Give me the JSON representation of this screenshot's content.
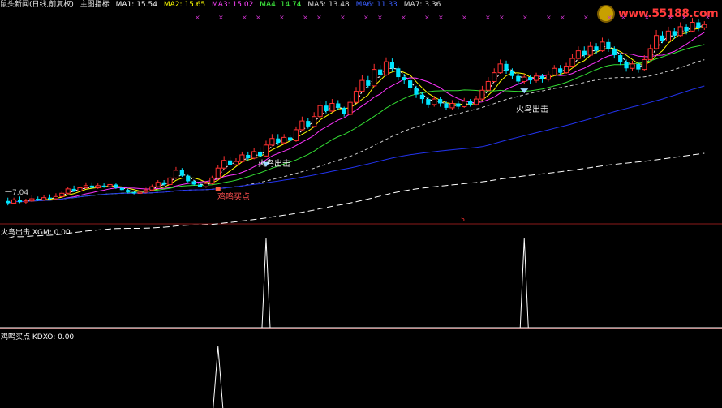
{
  "header": {
    "title": "鼠头新闻(日线,前复权)",
    "indicator": "主图指标",
    "ma_items": [
      {
        "label": "MA1: 15.54",
        "color": "#ffffff"
      },
      {
        "label": "MA2: 15.65",
        "color": "#ffff00"
      },
      {
        "label": "MA3: 15.02",
        "color": "#ff44ff"
      },
      {
        "label": "MA4: 14.74",
        "color": "#44ff44"
      },
      {
        "label": "MA5: 13.48",
        "color": "#dddddd"
      },
      {
        "label": "MA6: 11.33",
        "color": "#3a5fff"
      },
      {
        "label": "MA7: 3.36",
        "color": "#dddddd"
      }
    ]
  },
  "watermark": "www.55188.com",
  "panels": {
    "p2_label": "火鸟出击 XGM: 0.00",
    "p3_label": "鸡鸣买点 KDXO: 0.00"
  },
  "annotations": {
    "a1": "火鸟出击",
    "a2": "火鸟出击",
    "a3": "鸡鸣买点",
    "a4": "一7.04",
    "a5": "5"
  },
  "colors": {
    "up": "#ff3030",
    "down": "#00e5ff",
    "ma_white": "#ffffff",
    "ma_yellow": "#ffff00",
    "ma_magenta": "#ff33ff",
    "ma_green": "#33dd33",
    "ma_light": "#cccccc",
    "ma_blue": "#2233ee",
    "divider": "#8b1a1a"
  },
  "chart_data": {
    "type": "candlestick",
    "candles": [
      [
        8.5,
        8.3,
        8.8,
        8.1
      ],
      [
        8.3,
        8.6,
        8.8,
        8.2
      ],
      [
        8.6,
        8.4,
        8.9,
        8.3
      ],
      [
        8.4,
        8.5,
        8.7,
        8.2
      ],
      [
        8.5,
        8.7,
        9.0,
        8.4
      ],
      [
        8.7,
        8.6,
        8.9,
        8.5
      ],
      [
        8.6,
        8.8,
        9.0,
        8.5
      ],
      [
        8.8,
        8.7,
        9.1,
        8.6
      ],
      [
        8.7,
        8.9,
        9.2,
        8.6
      ],
      [
        8.9,
        9.2,
        9.4,
        8.8
      ],
      [
        9.2,
        9.6,
        9.8,
        9.1
      ],
      [
        9.6,
        9.4,
        9.9,
        9.3
      ],
      [
        9.4,
        9.7,
        10.0,
        9.3
      ],
      [
        9.7,
        9.9,
        10.2,
        9.6
      ],
      [
        9.9,
        9.7,
        10.2,
        9.6
      ],
      [
        9.7,
        9.9,
        10.1,
        9.6
      ],
      [
        9.9,
        9.8,
        10.1,
        9.7
      ],
      [
        9.8,
        10.0,
        10.2,
        9.7
      ],
      [
        10.0,
        9.7,
        10.1,
        9.6
      ],
      [
        9.7,
        9.5,
        9.8,
        9.4
      ],
      [
        9.5,
        9.3,
        9.6,
        9.2
      ],
      [
        9.3,
        9.2,
        9.4,
        9.1
      ],
      [
        9.2,
        9.3,
        9.5,
        9.1
      ],
      [
        9.3,
        9.5,
        9.7,
        9.2
      ],
      [
        9.5,
        9.8,
        10.0,
        9.4
      ],
      [
        9.8,
        10.2,
        10.4,
        9.7
      ],
      [
        10.2,
        10.0,
        10.4,
        9.9
      ],
      [
        10.0,
        10.6,
        10.8,
        9.9
      ],
      [
        10.6,
        11.3,
        11.6,
        10.5
      ],
      [
        11.3,
        10.8,
        11.5,
        10.7
      ],
      [
        10.8,
        10.3,
        10.9,
        10.2
      ],
      [
        10.3,
        10.0,
        10.4,
        9.9
      ],
      [
        10.0,
        9.8,
        10.1,
        9.7
      ],
      [
        9.8,
        10.1,
        10.3,
        9.7
      ],
      [
        10.1,
        10.6,
        10.8,
        10.0
      ],
      [
        10.6,
        11.5,
        11.8,
        10.5
      ],
      [
        11.5,
        12.2,
        12.6,
        11.4
      ],
      [
        12.2,
        11.8,
        12.5,
        11.6
      ],
      [
        11.8,
        12.1,
        12.4,
        11.7
      ],
      [
        12.1,
        12.7,
        13.0,
        12.0
      ],
      [
        12.7,
        12.4,
        13.0,
        12.2
      ],
      [
        12.4,
        13.0,
        13.3,
        12.3
      ],
      [
        13.0,
        12.6,
        13.4,
        12.5
      ],
      [
        12.6,
        13.6,
        14.0,
        12.5
      ],
      [
        13.6,
        14.2,
        14.6,
        13.5
      ],
      [
        14.2,
        13.8,
        14.6,
        13.6
      ],
      [
        13.8,
        14.3,
        14.6,
        13.7
      ],
      [
        14.3,
        14.0,
        14.5,
        13.8
      ],
      [
        14.0,
        15.0,
        15.3,
        13.9
      ],
      [
        15.0,
        15.8,
        16.2,
        14.9
      ],
      [
        15.8,
        15.3,
        16.1,
        15.1
      ],
      [
        15.3,
        16.2,
        16.6,
        15.2
      ],
      [
        16.2,
        17.2,
        17.6,
        16.1
      ],
      [
        17.2,
        16.7,
        17.6,
        16.5
      ],
      [
        16.7,
        17.4,
        17.8,
        16.6
      ],
      [
        17.4,
        17.0,
        17.7,
        16.8
      ],
      [
        17.0,
        16.4,
        17.1,
        16.2
      ],
      [
        16.4,
        17.5,
        17.9,
        16.3
      ],
      [
        17.5,
        18.5,
        18.9,
        17.4
      ],
      [
        18.5,
        19.5,
        20.0,
        18.4
      ],
      [
        19.5,
        19.0,
        19.9,
        18.8
      ],
      [
        19.0,
        20.5,
        21.0,
        18.9
      ],
      [
        20.5,
        20.0,
        20.9,
        19.7
      ],
      [
        20.0,
        21.2,
        21.6,
        19.9
      ],
      [
        21.2,
        20.6,
        21.5,
        20.3
      ],
      [
        20.6,
        19.8,
        20.8,
        19.5
      ],
      [
        19.8,
        19.5,
        20.1,
        19.2
      ],
      [
        19.5,
        18.8,
        19.8,
        18.5
      ],
      [
        18.8,
        18.2,
        19.0,
        17.9
      ],
      [
        18.2,
        17.8,
        18.4,
        17.4
      ],
      [
        17.8,
        17.3,
        18.0,
        17.0
      ],
      [
        17.3,
        17.8,
        18.1,
        17.1
      ],
      [
        17.8,
        17.4,
        18.0,
        17.1
      ],
      [
        17.4,
        17.0,
        17.6,
        16.8
      ],
      [
        17.0,
        17.4,
        17.7,
        16.8
      ],
      [
        17.4,
        17.1,
        17.6,
        16.9
      ],
      [
        17.1,
        17.6,
        17.9,
        17.0
      ],
      [
        17.6,
        17.3,
        17.8,
        17.1
      ],
      [
        17.3,
        17.8,
        18.1,
        17.2
      ],
      [
        17.8,
        18.6,
        19.0,
        17.7
      ],
      [
        18.6,
        19.4,
        19.8,
        18.5
      ],
      [
        19.4,
        20.2,
        20.6,
        19.3
      ],
      [
        20.2,
        21.0,
        21.4,
        20.1
      ],
      [
        21.0,
        20.4,
        21.3,
        20.1
      ],
      [
        20.4,
        19.9,
        20.6,
        19.6
      ],
      [
        19.9,
        19.4,
        20.1,
        19.1
      ],
      [
        19.4,
        19.8,
        20.1,
        19.2
      ],
      [
        19.8,
        19.5,
        20.0,
        19.2
      ],
      [
        19.5,
        19.9,
        20.2,
        19.3
      ],
      [
        19.9,
        19.6,
        20.1,
        19.3
      ],
      [
        19.6,
        20.0,
        20.3,
        19.4
      ],
      [
        20.0,
        20.6,
        20.9,
        19.9
      ],
      [
        20.6,
        20.2,
        20.9,
        20.0
      ],
      [
        20.2,
        20.8,
        21.1,
        20.1
      ],
      [
        20.8,
        21.5,
        21.9,
        20.7
      ],
      [
        21.5,
        22.2,
        22.6,
        21.4
      ],
      [
        22.2,
        21.8,
        22.6,
        21.6
      ],
      [
        21.8,
        22.6,
        23.0,
        21.7
      ],
      [
        22.6,
        22.2,
        22.9,
        21.9
      ],
      [
        22.2,
        23.0,
        23.4,
        22.1
      ],
      [
        23.0,
        22.4,
        23.3,
        22.1
      ],
      [
        22.4,
        21.8,
        22.6,
        21.5
      ],
      [
        21.8,
        21.2,
        22.0,
        20.9
      ],
      [
        21.2,
        20.6,
        21.4,
        20.3
      ],
      [
        20.6,
        21.0,
        21.3,
        20.4
      ],
      [
        21.0,
        20.5,
        21.2,
        20.2
      ],
      [
        20.5,
        21.4,
        21.8,
        20.4
      ],
      [
        21.4,
        22.4,
        22.8,
        21.3
      ],
      [
        22.4,
        23.6,
        24.1,
        22.3
      ],
      [
        23.6,
        23.1,
        24.0,
        22.9
      ],
      [
        23.1,
        24.0,
        24.4,
        23.0
      ],
      [
        24.0,
        23.6,
        24.3,
        23.3
      ],
      [
        23.6,
        24.4,
        24.8,
        23.5
      ],
      [
        24.4,
        24.0,
        24.6,
        23.7
      ],
      [
        24.0,
        24.8,
        25.2,
        23.9
      ],
      [
        24.8,
        24.3,
        25.1,
        24.0
      ],
      [
        24.3,
        24.6,
        24.9,
        24.1
      ]
    ],
    "price_range": [
      7.0,
      25.8
    ],
    "signal_xgm": [
      0,
      0,
      0,
      0,
      0,
      0,
      0,
      0,
      0,
      0,
      0,
      0,
      0,
      0,
      0,
      0,
      0,
      0,
      0,
      0,
      0,
      0,
      0,
      0,
      0,
      0,
      0,
      0,
      0,
      0,
      0,
      0,
      0,
      0,
      0,
      0,
      0,
      0,
      0,
      0,
      0,
      0,
      0,
      0,
      0,
      0,
      0,
      0,
      0,
      0,
      0,
      0,
      0,
      0,
      0,
      0,
      0,
      0,
      0,
      0,
      0,
      0,
      0,
      0,
      0,
      0,
      0,
      0,
      0,
      0,
      0,
      0,
      0,
      0,
      0,
      0,
      0,
      0,
      0,
      0,
      0,
      0,
      0,
      0,
      0,
      0,
      0,
      0,
      0,
      0,
      0,
      0,
      0,
      0,
      0,
      0,
      0,
      0,
      0,
      0,
      0,
      0,
      0,
      0,
      0,
      0,
      0,
      0,
      0,
      0,
      0,
      0,
      0,
      0,
      0,
      0,
      0,
      0,
      0,
      0
    ],
    "signal_xgm_spikes": [
      43,
      86
    ],
    "signal_kdxo_spikes": [
      35
    ]
  }
}
